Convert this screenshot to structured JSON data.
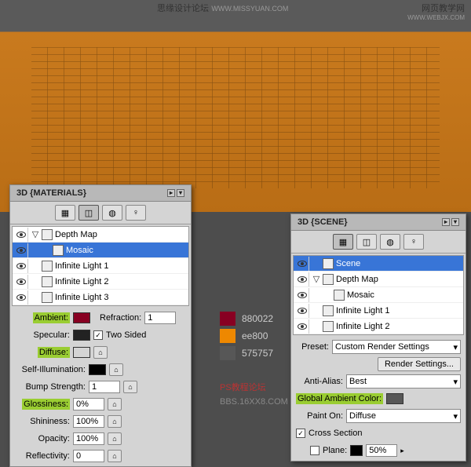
{
  "header": {
    "left": "思缘设计论坛",
    "left_sub": "WWW.MISSYUAN.COM",
    "right": "网页教学网",
    "right_sub": "WWW.WEBJX.COM"
  },
  "mat_panel": {
    "title": "3D {MATERIALS}",
    "tree": [
      {
        "label": "Depth Map",
        "indent": 0,
        "expanded": true
      },
      {
        "label": "Mosaic",
        "indent": 1,
        "sel": true
      },
      {
        "label": "Infinite Light 1",
        "indent": 0
      },
      {
        "label": "Infinite Light 2",
        "indent": 0
      },
      {
        "label": "Infinite Light 3",
        "indent": 0
      }
    ],
    "props": {
      "ambient": "Ambient:",
      "refraction_lbl": "Refraction:",
      "refraction": "1",
      "specular": "Specular:",
      "twosided": "Two Sided",
      "diffuse": "Diffuse:",
      "diffuse_color": "#ee8800",
      "selfillum": "Self-Illumination:",
      "bump": "Bump Strength:",
      "bump_v": "1",
      "gloss": "Glossiness:",
      "gloss_v": "0%",
      "shin": "Shininess:",
      "shin_v": "100%",
      "opac": "Opacity:",
      "opac_v": "100%",
      "refl": "Reflectivity:",
      "refl_v": "0"
    }
  },
  "scene_panel": {
    "title": "3D {SCENE}",
    "tree": [
      {
        "label": "Scene",
        "indent": 0,
        "sel": true
      },
      {
        "label": "Depth Map",
        "indent": 0,
        "expanded": true
      },
      {
        "label": "Mosaic",
        "indent": 1
      },
      {
        "label": "Infinite Light 1",
        "indent": 0
      },
      {
        "label": "Infinite Light 2",
        "indent": 0
      }
    ],
    "props": {
      "preset": "Preset:",
      "preset_v": "Custom Render Settings",
      "render_btn": "Render Settings...",
      "aa": "Anti-Alias:",
      "aa_v": "Best",
      "gac": "Global Ambient Color:",
      "gac_color": "#575757",
      "paint": "Paint On:",
      "paint_v": "Diffuse",
      "cross": "Cross Section",
      "plane": "Plane:",
      "plane_v": "50%"
    }
  },
  "palette": [
    {
      "c": "#880022",
      "l": "880022"
    },
    {
      "c": "#ee8800",
      "l": "ee800"
    },
    {
      "c": "#575757",
      "l": "575757"
    }
  ],
  "footer": {
    "l1": "PS教程论坛",
    "l2": "BBS.16XX8.COM"
  }
}
